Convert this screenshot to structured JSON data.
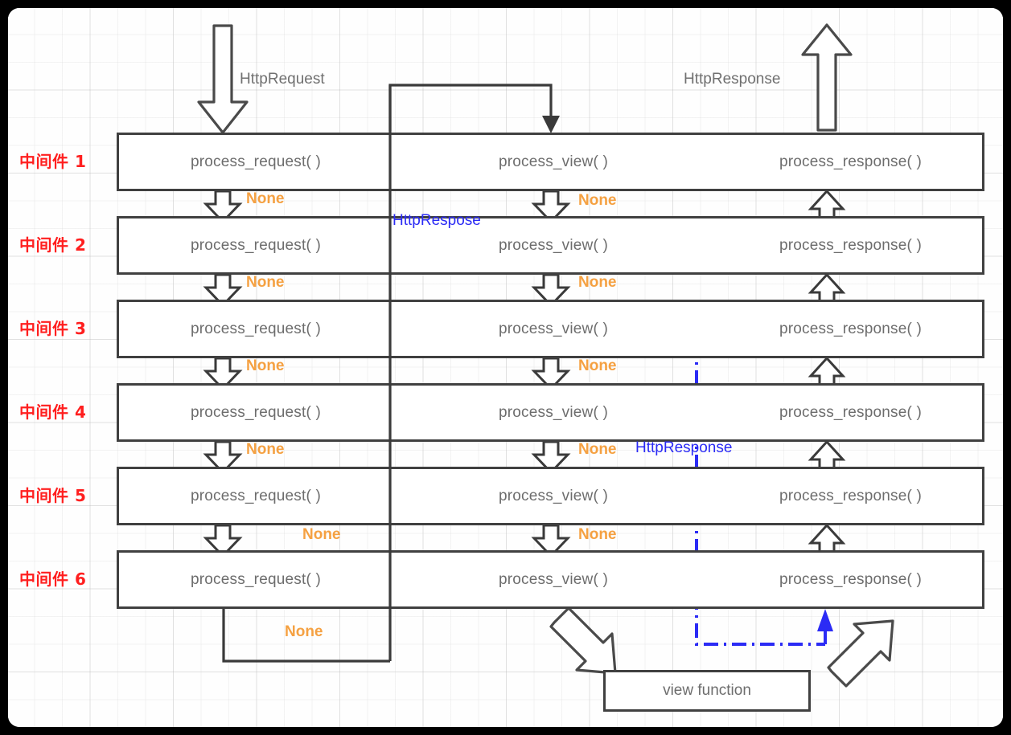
{
  "diagram": {
    "title": "Django middleware request/response flow",
    "colors": {
      "middleware_label": "#ff1f1f",
      "none_label": "#f5a142",
      "http_response_blue": "#2b2bf5",
      "box_stroke": "#404040",
      "text_grey": "#6d6d6d"
    },
    "top_labels": {
      "request": "HttpRequest",
      "response": "HttpResponse"
    },
    "columns": [
      {
        "key": "request",
        "label": "process_request( )"
      },
      {
        "key": "view",
        "label": "process_view( )"
      },
      {
        "key": "response",
        "label": "process_response( )"
      }
    ],
    "middlewares": [
      {
        "label": "中间件 1",
        "request": "process_request( )",
        "view": "process_view( )",
        "response": "process_response( )"
      },
      {
        "label": "中间件 2",
        "request": "process_request( )",
        "view": "process_view( )",
        "response": "process_response( )"
      },
      {
        "label": "中间件 3",
        "request": "process_request( )",
        "view": "process_view( )",
        "response": "process_response( )"
      },
      {
        "label": "中间件 4",
        "request": "process_request( )",
        "view": "process_view( )",
        "response": "process_response( )"
      },
      {
        "label": "中间件 5",
        "request": "process_request( )",
        "view": "process_view( )",
        "response": "process_response( )"
      },
      {
        "label": "中间件 6",
        "request": "process_request( )",
        "view": "process_view( )",
        "response": "process_response( )"
      }
    ],
    "none_labels_request": [
      "None",
      "None",
      "None",
      "None",
      "None"
    ],
    "none_labels_view": [
      "None",
      "None",
      "None",
      "None",
      "None"
    ],
    "none_label_bottom": "None",
    "blue_labels": {
      "middleware2": "HttpRespose",
      "middleware5": "HttpResponse"
    },
    "view_function": {
      "label": "view function"
    }
  }
}
